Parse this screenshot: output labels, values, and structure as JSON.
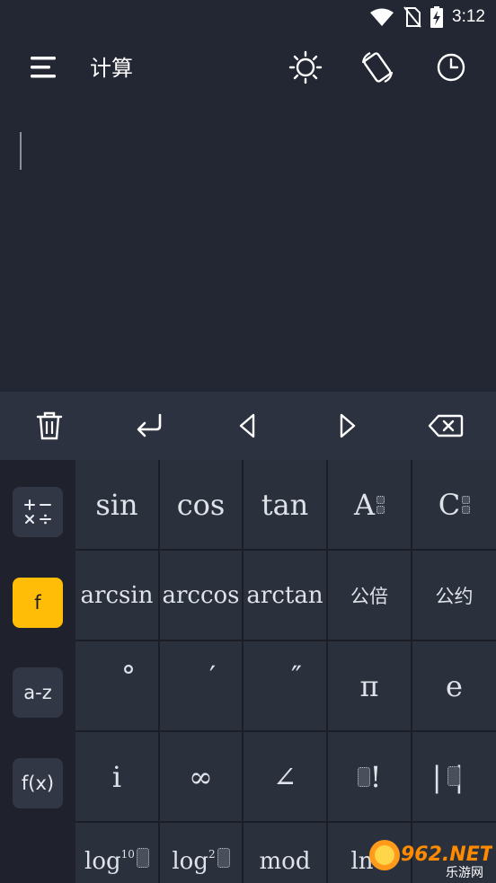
{
  "status_bar": {
    "time": "3:12",
    "icons": [
      "wifi-icon",
      "no-sim-icon",
      "battery-charging-icon"
    ]
  },
  "app_bar": {
    "title": "计算",
    "icons": [
      "menu-icon",
      "theme-brightness-icon",
      "screen-rotate-icon",
      "history-clock-icon"
    ]
  },
  "display": {
    "expression": ""
  },
  "toolbar": {
    "icons": [
      "trash-icon",
      "enter-icon",
      "cursor-left-icon",
      "cursor-right-icon",
      "backspace-icon"
    ]
  },
  "sidebar": {
    "items": [
      {
        "label": "+−×÷",
        "active": false
      },
      {
        "label": "f",
        "active": true
      },
      {
        "label": "a-z",
        "active": false
      },
      {
        "label": "f(x)",
        "active": false
      }
    ]
  },
  "keys": {
    "row1": [
      "sin",
      "cos",
      "tan",
      "A",
      "C"
    ],
    "row2": [
      "arcsin",
      "arccos",
      "arctan",
      "公倍",
      "公约"
    ],
    "row3": [
      "°",
      "′",
      "″",
      "π",
      "e"
    ],
    "row4": [
      "i",
      "∞",
      "∠",
      "!",
      "||"
    ],
    "row5": [
      "log",
      "10",
      "log",
      "2",
      "mod",
      "ln"
    ]
  },
  "watermark": {
    "text": "962.NET",
    "sub": "乐游网"
  },
  "colors": {
    "background": "#232733",
    "keypad": "#2b303d",
    "accent": "#ffbd07"
  }
}
